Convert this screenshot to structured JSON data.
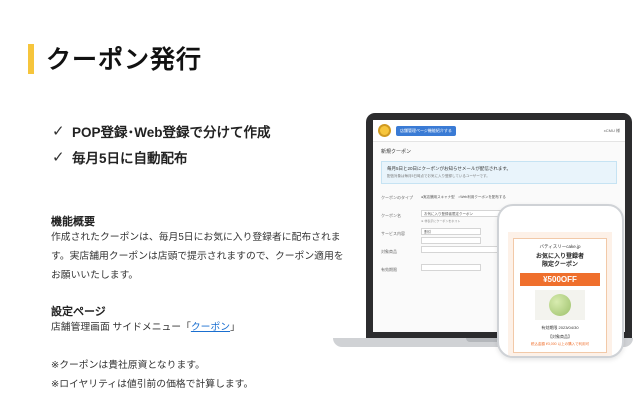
{
  "page": {
    "title": "クーポン発行",
    "features": [
      "POP登録･Web登録で分けて作成",
      "毎月5日に自動配布"
    ],
    "overview": {
      "heading": "機能概要",
      "body": "作成されたクーポンは、毎月5日にお気に入り登録者に配布されます。実店舗用クーポンは店頭で提示されますので、クーポン適用をお願いいたします。"
    },
    "settings": {
      "heading": "設定ページ",
      "path_text": "店舗管理画面 サイドメニュー「",
      "link_text": "クーポン",
      "path_end": "」"
    },
    "notes": [
      "※クーポンは貴社原資となります。",
      "※ロイヤリティは値引前の価格で計算します。"
    ]
  },
  "laptop_screen": {
    "header_button": "店舗管理ページ機能紹介する",
    "user_label": "xCMU 様",
    "heading": "新規クーポン",
    "info_main": "毎月5日と20日にクーポンがお知らせメールが配信されます。",
    "info_sub": "配信対象は毎月5日時点でお気に入り登録しているユーザーです。",
    "form": [
      {
        "label": "クーポンのタイプ",
        "value": "●実店舗用スキャナ型　○Web利用クーポンを配布する"
      },
      {
        "label": "クーポン名",
        "value": "お気に入り登録者限定クーポン"
      },
      {
        "label": "サービス内容",
        "value": "割引"
      },
      {
        "label": "対象商品",
        "value": ""
      },
      {
        "label": "有効期限",
        "value": ""
      }
    ],
    "form_note": "※ 非表示にクーポンをホスト"
  },
  "phone_screen": {
    "shop": "バティスリーcake.jp",
    "title_line1": "お気に入り登録者",
    "title_line2": "限定クーポン",
    "discount": "¥500OFF",
    "expiry": "有効期限 2023/04/30",
    "target": "【対象商品】",
    "condition": "税込金額 ¥3,000 以上の購入で利用可"
  },
  "colors": {
    "accent_yellow": "#f6c53c",
    "link_blue": "#1a6fd0",
    "coupon_orange": "#ef6f2c"
  }
}
